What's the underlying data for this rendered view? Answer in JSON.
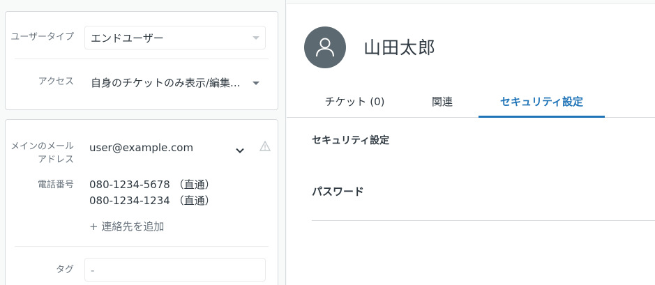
{
  "left_panel": {
    "card1": {
      "user_type": {
        "label": "ユーザータイプ",
        "value": "エンドユーザー"
      },
      "access": {
        "label": "アクセス",
        "value": "自身のチケットのみ表示/編集..."
      }
    },
    "card2": {
      "main_email": {
        "label_line1": "メインのメール",
        "label_line2": "アドレス",
        "value": "user@example.com"
      },
      "phone": {
        "label": "電話番号",
        "numbers": [
          "080-1234-5678 （直通）",
          "080-1234-1234 （直通）"
        ],
        "add_label": "+ 連絡先を追加"
      },
      "tags": {
        "label": "タグ",
        "placeholder": "-"
      }
    }
  },
  "profile": {
    "name": "山田太郎",
    "avatar_color": "#5c6970"
  },
  "tabs": [
    {
      "label": "チケット (0)",
      "active": false
    },
    {
      "label": "関連",
      "active": false
    },
    {
      "label": "セキュリティ設定",
      "active": true
    }
  ],
  "security": {
    "section_title": "セキュリティ設定",
    "password_label": "パスワード"
  },
  "colors": {
    "accent": "#1f73b7",
    "text": "#2f3941",
    "muted": "#68737d"
  },
  "icons": [
    "user-avatar-icon",
    "chevron-down-icon",
    "warning-icon",
    "caret-down-icon"
  ]
}
